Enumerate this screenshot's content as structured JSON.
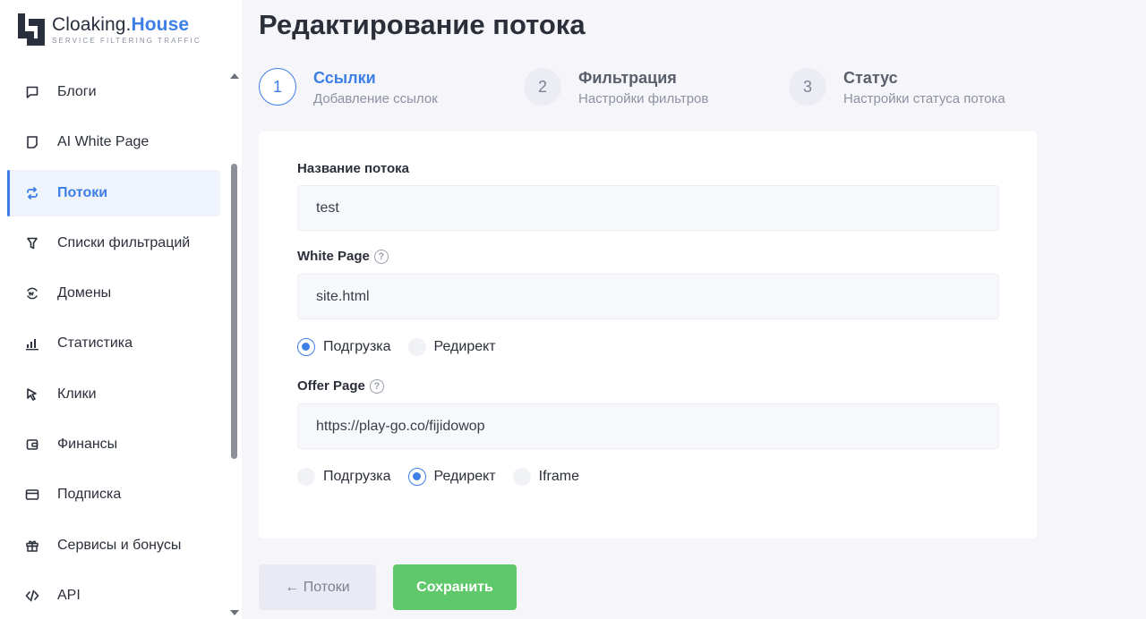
{
  "brand": {
    "name_part1": "Cloaking.",
    "name_part2": "House",
    "tagline": "SERVICE FILTERING TRAFFIC"
  },
  "colors": {
    "accent": "#3d7fe6",
    "save": "#5ec86a",
    "background": "#f6f6fa"
  },
  "sidebar": {
    "items": [
      {
        "label": "Блоги",
        "icon": "chat-icon"
      },
      {
        "label": "AI White Page",
        "icon": "page-icon"
      },
      {
        "label": "Потоки",
        "icon": "sync-icon",
        "active": true
      },
      {
        "label": "Списки фильтраций",
        "icon": "filter-icon"
      },
      {
        "label": "Домены",
        "icon": "domain-icon"
      },
      {
        "label": "Статистика",
        "icon": "bar-chart-icon"
      },
      {
        "label": "Клики",
        "icon": "cursor-icon"
      },
      {
        "label": "Финансы",
        "icon": "wallet-icon"
      },
      {
        "label": "Подписка",
        "icon": "card-icon"
      },
      {
        "label": "Сервисы и бонусы",
        "icon": "gift-icon"
      },
      {
        "label": "API",
        "icon": "code-icon"
      }
    ]
  },
  "page": {
    "title": "Редактирование потока"
  },
  "steps": [
    {
      "number": "1",
      "title": "Ссылки",
      "subtitle": "Добавление ссылок",
      "active": true
    },
    {
      "number": "2",
      "title": "Фильтрация",
      "subtitle": "Настройки фильтров"
    },
    {
      "number": "3",
      "title": "Статус",
      "subtitle": "Настройки статуса потока"
    }
  ],
  "form": {
    "stream_name": {
      "label": "Название потока",
      "value": "test"
    },
    "white_page": {
      "label": "White Page",
      "value": "site.html",
      "options": [
        "Подгрузка",
        "Редирект"
      ],
      "selected": "Подгрузка"
    },
    "offer_page": {
      "label": "Offer Page",
      "value": "https://play-go.co/fijidowop",
      "options": [
        "Подгрузка",
        "Редирект",
        "Iframe"
      ],
      "selected": "Редирект"
    },
    "help_glyph": "?"
  },
  "actions": {
    "back_label": "← Потоки",
    "save_label": "Сохранить"
  }
}
